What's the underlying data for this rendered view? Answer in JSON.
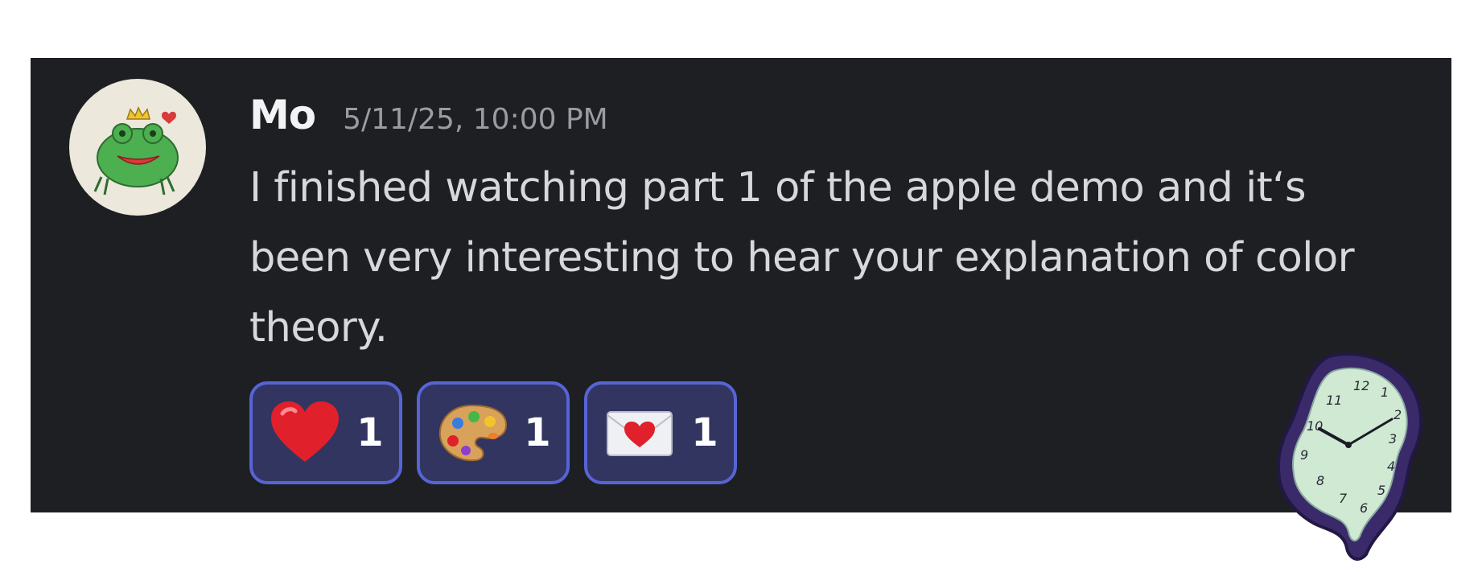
{
  "message": {
    "author": "Mo",
    "timestamp": "5/11/25, 10:00 PM",
    "text": "I finished watching part 1 of the apple demo and it‘s been very interesting to hear your explanation of color theory."
  },
  "reactions": [
    {
      "emoji": "heart-emoji",
      "count": "1"
    },
    {
      "emoji": "artist-palette-emoji",
      "count": "1"
    },
    {
      "emoji": "love-letter-emoji",
      "count": "1"
    }
  ],
  "sticker": {
    "name": "melting-clock-sticker",
    "numerals": [
      "12",
      "1",
      "2",
      "3",
      "4",
      "5",
      "6",
      "7",
      "8",
      "9",
      "10",
      "11"
    ]
  },
  "colors": {
    "card_background": "#1e1f23",
    "reaction_border": "#5764d6",
    "reaction_fill": "#323560"
  }
}
